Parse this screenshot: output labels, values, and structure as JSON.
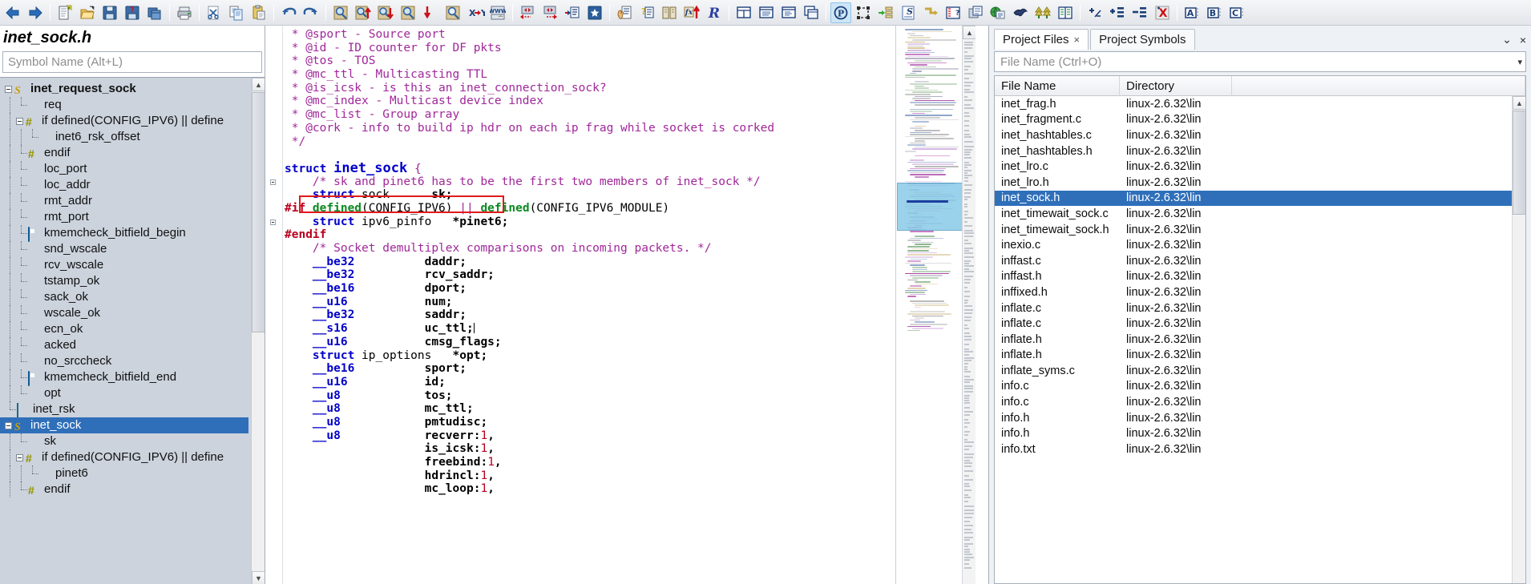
{
  "toolbar": {
    "groups": [
      {
        "buttons": [
          {
            "name": "back-icon",
            "label": "Back",
            "glyph": "arrow-left"
          },
          {
            "name": "forward-icon",
            "label": "Forward",
            "glyph": "arrow-right"
          }
        ]
      },
      {
        "buttons": [
          {
            "name": "new-file-icon",
            "label": "New File",
            "glyph": "new-doc"
          },
          {
            "name": "open-file-icon",
            "label": "Open File",
            "glyph": "folder-open"
          },
          {
            "name": "save-icon",
            "label": "Save",
            "glyph": "floppy"
          },
          {
            "name": "save-as-icon",
            "label": "Save As",
            "glyph": "floppy-query"
          },
          {
            "name": "close-file-icon",
            "label": "Close File",
            "glyph": "windows-stack"
          }
        ]
      },
      {
        "buttons": [
          {
            "name": "print-icon",
            "label": "Print",
            "glyph": "printer"
          }
        ]
      },
      {
        "buttons": [
          {
            "name": "cut-icon",
            "label": "Cut",
            "glyph": "scissors"
          },
          {
            "name": "copy-icon",
            "label": "Copy",
            "glyph": "copy"
          },
          {
            "name": "paste-icon",
            "label": "Paste",
            "glyph": "clipboard"
          }
        ]
      },
      {
        "buttons": [
          {
            "name": "undo-icon",
            "label": "Undo",
            "glyph": "undo"
          },
          {
            "name": "redo-icon",
            "label": "Redo",
            "glyph": "redo"
          }
        ]
      },
      {
        "buttons": [
          {
            "name": "search-icon",
            "label": "Search",
            "glyph": "magnifier"
          },
          {
            "name": "search-backward-icon",
            "label": "Search Backward",
            "glyph": "magnifier-up"
          },
          {
            "name": "search-forward-icon",
            "label": "Search Forward",
            "glyph": "magnifier-down"
          },
          {
            "name": "search-files-icon",
            "label": "Search Files",
            "glyph": "magnifier-plain"
          },
          {
            "name": "search-again-icon",
            "label": "Search Again",
            "glyph": "magnifier-red-down"
          },
          {
            "name": "lookup-reference-icon",
            "label": "Lookup References",
            "glyph": "magnifier-doc"
          },
          {
            "name": "replace-icon",
            "label": "Replace",
            "glyph": "x-to-y"
          },
          {
            "name": "browse-web-icon",
            "label": "Browse Web",
            "glyph": "www"
          }
        ]
      },
      {
        "buttons": [
          {
            "name": "jump-back-icon",
            "label": "Jump Back",
            "glyph": "jump-left"
          },
          {
            "name": "jump-forward-icon",
            "label": "Jump Forward",
            "glyph": "jump-right"
          },
          {
            "name": "jump-to-definition-icon",
            "label": "Jump To Definition",
            "glyph": "goto-def"
          },
          {
            "name": "bookmark-icon",
            "label": "Bookmark",
            "glyph": "star-book"
          }
        ]
      },
      {
        "buttons": [
          {
            "name": "browse-symbols-icon",
            "label": "Browse Project Symbols",
            "glyph": "hand-doc"
          },
          {
            "name": "symbol-info-icon",
            "label": "Symbol Info",
            "glyph": "question-doc"
          },
          {
            "name": "project-window-icon",
            "label": "Project Window",
            "glyph": "book"
          },
          {
            "name": "function-jump-icon",
            "label": "Jump To Function",
            "glyph": "fx-up"
          },
          {
            "name": "relation-window-icon",
            "label": "Relation Window",
            "glyph": "R"
          }
        ]
      },
      {
        "buttons": [
          {
            "name": "tile-windows-icon",
            "label": "Tile Windows",
            "glyph": "tile"
          },
          {
            "name": "context-window-icon",
            "label": "Context Window",
            "glyph": "ctx"
          },
          {
            "name": "symbol-window-icon",
            "label": "Symbol Window",
            "glyph": "symwin"
          },
          {
            "name": "clone-window-icon",
            "label": "Clone Window",
            "glyph": "clone"
          }
        ]
      },
      {
        "buttons": [
          {
            "name": "paragraph-marks-icon",
            "label": "Show Paragraph Marks",
            "glyph": "pilcrow",
            "active": true
          },
          {
            "name": "select-block-icon",
            "label": "Select Block",
            "glyph": "block-select"
          },
          {
            "name": "indent-icon",
            "label": "Indent",
            "glyph": "indent"
          },
          {
            "name": "smart-rename-icon",
            "label": "Smart Rename",
            "glyph": "s-doc"
          },
          {
            "name": "reformat-icon",
            "label": "Reformat",
            "glyph": "corner"
          },
          {
            "name": "syntax-format-icon",
            "label": "Syntax Formatting",
            "glyph": "syntax"
          },
          {
            "name": "clone-file-icon",
            "label": "Clone File",
            "glyph": "clone2"
          },
          {
            "name": "sync-web-icon",
            "label": "Sync",
            "glyph": "globe-doc"
          },
          {
            "name": "source-dynamics-icon",
            "label": "Source Dynamics",
            "glyph": "eagle"
          },
          {
            "name": "compare-files-icon",
            "label": "Compare Files",
            "glyph": "two-trees"
          },
          {
            "name": "side-by-side-icon",
            "label": "Side By Side",
            "glyph": "book-pages"
          }
        ]
      },
      {
        "buttons": [
          {
            "name": "add-remove-icon",
            "label": "Add/Remove",
            "glyph": "plus-minus"
          },
          {
            "name": "add-list-icon",
            "label": "Add To List",
            "glyph": "plus-list"
          },
          {
            "name": "remove-list-icon",
            "label": "Remove From List",
            "glyph": "minus-list"
          },
          {
            "name": "clear-list-icon",
            "label": "Clear List",
            "glyph": "x-list"
          }
        ]
      },
      {
        "buttons": [
          {
            "name": "bookmark-a-icon",
            "label": "Bookmark A",
            "glyph": "A"
          },
          {
            "name": "bookmark-b-icon",
            "label": "Bookmark B",
            "glyph": "B"
          },
          {
            "name": "bookmark-c-icon",
            "label": "Bookmark C",
            "glyph": "C"
          }
        ]
      }
    ]
  },
  "left_panel": {
    "title": "inet_sock.h",
    "search_placeholder": "Symbol Name (Alt+L)",
    "tree": [
      {
        "depth": 0,
        "icon": "struct",
        "label": "inet_request_sock",
        "expander": "minus",
        "bold": true
      },
      {
        "depth": 1,
        "icon": "diamond",
        "label": "req"
      },
      {
        "depth": 1,
        "icon": "hash",
        "label": "if defined(CONFIG_IPV6) || define",
        "expander": "minus"
      },
      {
        "depth": 2,
        "icon": "diamond",
        "label": "inet6_rsk_offset"
      },
      {
        "depth": 1,
        "icon": "hash",
        "label": "endif"
      },
      {
        "depth": 1,
        "icon": "diamond",
        "label": "loc_port"
      },
      {
        "depth": 1,
        "icon": "diamond",
        "label": "loc_addr"
      },
      {
        "depth": 1,
        "icon": "diamond",
        "label": "rmt_addr"
      },
      {
        "depth": 1,
        "icon": "diamond",
        "label": "rmt_port"
      },
      {
        "depth": 1,
        "icon": "macro",
        "label": "kmemcheck_bitfield_begin"
      },
      {
        "depth": 1,
        "icon": "diamond",
        "label": "snd_wscale"
      },
      {
        "depth": 1,
        "icon": "diamond",
        "label": "rcv_wscale"
      },
      {
        "depth": 1,
        "icon": "diamond",
        "label": "tstamp_ok"
      },
      {
        "depth": 1,
        "icon": "diamond",
        "label": "sack_ok"
      },
      {
        "depth": 1,
        "icon": "diamond",
        "label": "wscale_ok"
      },
      {
        "depth": 1,
        "icon": "diamond",
        "label": "ecn_ok"
      },
      {
        "depth": 1,
        "icon": "diamond",
        "label": "acked"
      },
      {
        "depth": 1,
        "icon": "diamond",
        "label": "no_srccheck"
      },
      {
        "depth": 1,
        "icon": "macro",
        "label": "kmemcheck_bitfield_end"
      },
      {
        "depth": 1,
        "icon": "diamond",
        "label": "opt"
      },
      {
        "depth": 0,
        "icon": "tstruct",
        "label": "inet_rsk"
      },
      {
        "depth": 0,
        "icon": "struct",
        "label": "inet_sock",
        "expander": "minus",
        "selected": true
      },
      {
        "depth": 1,
        "icon": "diamond",
        "label": "sk"
      },
      {
        "depth": 1,
        "icon": "hash",
        "label": "if defined(CONFIG_IPV6) || define",
        "expander": "minus"
      },
      {
        "depth": 2,
        "icon": "diamond",
        "label": "pinet6"
      },
      {
        "depth": 1,
        "icon": "hash",
        "label": "endif"
      }
    ]
  },
  "editor": {
    "lines": [
      [
        {
          "t": " * @sport - Source port",
          "c": "cm"
        }
      ],
      [
        {
          "t": " * @id - ID counter for DF pkts",
          "c": "cm"
        }
      ],
      [
        {
          "t": " * @tos - TOS",
          "c": "cm"
        }
      ],
      [
        {
          "t": " * @mc_ttl - Multicasting TTL",
          "c": "cm"
        }
      ],
      [
        {
          "t": " * @is_icsk - is this an inet_connection_sock?",
          "c": "cm"
        }
      ],
      [
        {
          "t": " * @mc_index - Multicast device index",
          "c": "cm"
        }
      ],
      [
        {
          "t": " * @mc_list - Group array",
          "c": "cm"
        }
      ],
      [
        {
          "t": " * @cork - info to build ip hdr on each ip frag while socket is corked",
          "c": "cm"
        }
      ],
      [
        {
          "t": " */",
          "c": "cm"
        }
      ],
      [],
      [
        {
          "t": "struct ",
          "c": "kw"
        },
        {
          "t": "inet_sock",
          "c": "big"
        },
        {
          "t": " {",
          "c": "op"
        }
      ],
      [
        {
          "t": "    /* sk and pinet6 has to be the first two members of inet_sock */",
          "c": "cm"
        }
      ],
      [
        {
          "t": "    ",
          "c": "id"
        },
        {
          "t": "struct",
          "c": "kw"
        },
        {
          "t": " sock      ",
          "c": "id"
        },
        {
          "t": "sk;",
          "c": "ty"
        }
      ],
      [
        {
          "t": "#if ",
          "c": "ppk"
        },
        {
          "t": "defined",
          "c": "pp"
        },
        {
          "t": "(CONFIG_IPV6) ",
          "c": "id"
        },
        {
          "t": "||",
          "c": "op"
        },
        {
          "t": " ",
          "c": "id"
        },
        {
          "t": "defined",
          "c": "pp"
        },
        {
          "t": "(CONFIG_IPV6_MODULE)",
          "c": "id"
        }
      ],
      [
        {
          "t": "    ",
          "c": "id"
        },
        {
          "t": "struct",
          "c": "kw"
        },
        {
          "t": " ipv6_pinfo   ",
          "c": "id"
        },
        {
          "t": "*pinet6;",
          "c": "ty"
        }
      ],
      [
        {
          "t": "#endif",
          "c": "ppk"
        }
      ],
      [
        {
          "t": "    /* Socket demultiplex comparisons on incoming packets. */",
          "c": "cm"
        }
      ],
      [
        {
          "t": "    __be32          ",
          "c": "kw"
        },
        {
          "t": "daddr;",
          "c": "ty"
        }
      ],
      [
        {
          "t": "    __be32          ",
          "c": "kw"
        },
        {
          "t": "rcv_saddr;",
          "c": "ty"
        }
      ],
      [
        {
          "t": "    __be16          ",
          "c": "kw"
        },
        {
          "t": "dport;",
          "c": "ty"
        }
      ],
      [
        {
          "t": "    __u16           ",
          "c": "kw"
        },
        {
          "t": "num;",
          "c": "ty"
        }
      ],
      [
        {
          "t": "    __be32          ",
          "c": "kw"
        },
        {
          "t": "saddr;",
          "c": "ty"
        }
      ],
      [
        {
          "t": "    __s16           ",
          "c": "kw"
        },
        {
          "t": "uc_ttl;",
          "c": "ty"
        }
      ],
      [
        {
          "t": "    __u16           ",
          "c": "kw"
        },
        {
          "t": "cmsg_flags;",
          "c": "ty"
        }
      ],
      [
        {
          "t": "    ",
          "c": "id"
        },
        {
          "t": "struct",
          "c": "kw"
        },
        {
          "t": " ip_options   ",
          "c": "id"
        },
        {
          "t": "*opt;",
          "c": "ty"
        }
      ],
      [
        {
          "t": "    __be16          ",
          "c": "kw"
        },
        {
          "t": "sport;",
          "c": "ty"
        }
      ],
      [
        {
          "t": "    __u16           ",
          "c": "kw"
        },
        {
          "t": "id;",
          "c": "ty"
        }
      ],
      [
        {
          "t": "    __u8            ",
          "c": "kw"
        },
        {
          "t": "tos;",
          "c": "ty"
        }
      ],
      [
        {
          "t": "    __u8            ",
          "c": "kw"
        },
        {
          "t": "mc_ttl;",
          "c": "ty"
        }
      ],
      [
        {
          "t": "    __u8            ",
          "c": "kw"
        },
        {
          "t": "pmtudisc;",
          "c": "ty"
        }
      ],
      [
        {
          "t": "    __u8            ",
          "c": "kw"
        },
        {
          "t": "recverr:",
          "c": "ty"
        },
        {
          "t": "1",
          "c": "num"
        },
        {
          "t": ",",
          "c": "ty"
        }
      ],
      [
        {
          "t": "                    ",
          "c": "id"
        },
        {
          "t": "is_icsk:",
          "c": "ty"
        },
        {
          "t": "1",
          "c": "num"
        },
        {
          "t": ",",
          "c": "ty"
        }
      ],
      [
        {
          "t": "                    ",
          "c": "id"
        },
        {
          "t": "freebind:",
          "c": "ty"
        },
        {
          "t": "1",
          "c": "num"
        },
        {
          "t": ",",
          "c": "ty"
        }
      ],
      [
        {
          "t": "                    ",
          "c": "id"
        },
        {
          "t": "hdrincl:",
          "c": "ty"
        },
        {
          "t": "1",
          "c": "num"
        },
        {
          "t": ",",
          "c": "ty"
        }
      ],
      [
        {
          "t": "                    ",
          "c": "id"
        },
        {
          "t": "mc_loop:",
          "c": "ty"
        },
        {
          "t": "1",
          "c": "num"
        },
        {
          "t": ",",
          "c": "ty"
        }
      ]
    ],
    "annotation": {
      "name": "struct-sock-sk-highlight",
      "color": "#e01b1b"
    }
  },
  "minimap": {
    "name": "code-overview-minimap",
    "highlight_color": "#89c9e8"
  },
  "right_panel": {
    "tabs": [
      {
        "label": "Project Files",
        "selected": true,
        "closable": true
      },
      {
        "label": "Project Symbols",
        "selected": false,
        "closable": false
      }
    ],
    "tab_menu_glyph": "⌄",
    "close_glyph": "×",
    "filter_placeholder": "File Name (Ctrl+O)",
    "filter_value": "",
    "columns": [
      "File Name",
      "Directory"
    ],
    "rows": [
      {
        "file": "inet_frag.h",
        "dir": "linux-2.6.32\\lin"
      },
      {
        "file": "inet_fragment.c",
        "dir": "linux-2.6.32\\lin"
      },
      {
        "file": "inet_hashtables.c",
        "dir": "linux-2.6.32\\lin"
      },
      {
        "file": "inet_hashtables.h",
        "dir": "linux-2.6.32\\lin"
      },
      {
        "file": "inet_lro.c",
        "dir": "linux-2.6.32\\lin"
      },
      {
        "file": "inet_lro.h",
        "dir": "linux-2.6.32\\lin"
      },
      {
        "file": "inet_sock.h",
        "dir": "linux-2.6.32\\lin",
        "selected": true
      },
      {
        "file": "inet_timewait_sock.c",
        "dir": "linux-2.6.32\\lin"
      },
      {
        "file": "inet_timewait_sock.h",
        "dir": "linux-2.6.32\\lin"
      },
      {
        "file": "inexio.c",
        "dir": "linux-2.6.32\\lin"
      },
      {
        "file": "inffast.c",
        "dir": "linux-2.6.32\\lin"
      },
      {
        "file": "inffast.h",
        "dir": "linux-2.6.32\\lin"
      },
      {
        "file": "inffixed.h",
        "dir": "linux-2.6.32\\lin"
      },
      {
        "file": "inflate.c",
        "dir": "linux-2.6.32\\lin"
      },
      {
        "file": "inflate.c",
        "dir": "linux-2.6.32\\lin"
      },
      {
        "file": "inflate.h",
        "dir": "linux-2.6.32\\lin"
      },
      {
        "file": "inflate.h",
        "dir": "linux-2.6.32\\lin"
      },
      {
        "file": "inflate_syms.c",
        "dir": "linux-2.6.32\\lin"
      },
      {
        "file": "info.c",
        "dir": "linux-2.6.32\\lin"
      },
      {
        "file": "info.c",
        "dir": "linux-2.6.32\\lin"
      },
      {
        "file": "info.h",
        "dir": "linux-2.6.32\\lin"
      },
      {
        "file": "info.h",
        "dir": "linux-2.6.32\\lin"
      },
      {
        "file": "info.txt",
        "dir": "linux-2.6.32\\lin"
      }
    ]
  },
  "colors": {
    "selection_blue": "#2f6fba",
    "comment_purple": "#a0279a",
    "keyword_blue": "#0000c8",
    "preproc_green": "#0a8a20",
    "preproc_red": "#b8001f",
    "annotation_red": "#e01b1b",
    "minimap_highlight": "#89c9e8"
  }
}
